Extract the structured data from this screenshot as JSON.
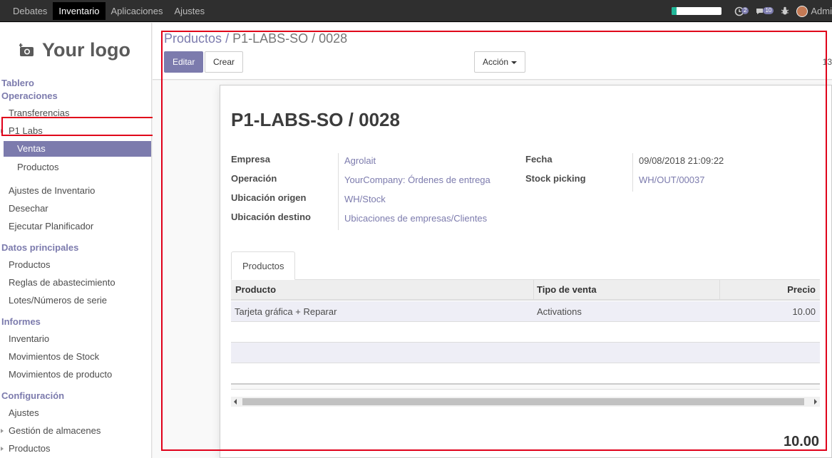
{
  "topbar": {
    "menu": [
      "Debates",
      "Inventario",
      "Aplicaciones",
      "Ajustes"
    ],
    "active": "Inventario",
    "progress_fraction": 0.1,
    "activity_badge": "2",
    "messages_badge": "10",
    "user": "Admi",
    "colors": {
      "bar": "#2f2f2f",
      "progress": "#21b799",
      "badge": "#7c7bad"
    }
  },
  "sidebar": {
    "logo_text": "Your logo",
    "tablero": "Tablero",
    "operaciones": "Operaciones",
    "items_ops": [
      "Transferencias",
      "P1 Labs"
    ],
    "p1labs_sub": [
      "Ventas",
      "Productos"
    ],
    "items_ops2": [
      "Ajustes de Inventario",
      "Desechar",
      "Ejecutar Planificador"
    ],
    "datos": "Datos principales",
    "items_datos": [
      "Productos",
      "Reglas de abastecimiento",
      "Lotes/Números de serie"
    ],
    "informes": "Informes",
    "items_informes": [
      "Inventario",
      "Movimientos de Stock",
      "Movimientos de producto"
    ],
    "config": "Configuración",
    "items_config": [
      "Ajustes",
      "Gestión de almacenes",
      "Productos"
    ]
  },
  "control_panel": {
    "breadcrumb_parent": "Productos",
    "breadcrumb_sep": "/",
    "breadcrumb_current": "P1-LABS-SO / 0028",
    "edit_label": "Editar",
    "create_label": "Crear",
    "action_label": "Acción",
    "pager": "13"
  },
  "record": {
    "title": "P1-LABS-SO / 0028",
    "fields_left": [
      {
        "label": "Empresa",
        "value": "Agrolait"
      },
      {
        "label": "Operación",
        "value": "YourCompany: Órdenes de entrega"
      },
      {
        "label": "Ubicación origen",
        "value": "WH/Stock"
      },
      {
        "label": "Ubicación destino",
        "value": "Ubicaciones de empresas/Clientes"
      }
    ],
    "fields_right": [
      {
        "label": "Fecha",
        "value": "09/08/2018 21:09:22"
      },
      {
        "label": "Stock picking",
        "value": "WH/OUT/00037"
      }
    ],
    "tab_label": "Productos",
    "table": {
      "columns": [
        "Producto",
        "Tipo de venta",
        "Precio"
      ],
      "rows": [
        [
          "Tarjeta gráfica + Reparar",
          "Activations",
          "10.00"
        ]
      ]
    },
    "total": "10.00"
  }
}
